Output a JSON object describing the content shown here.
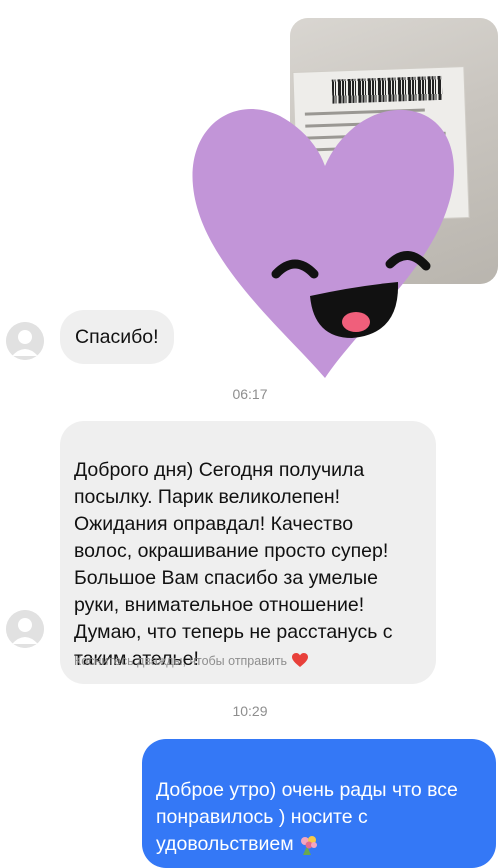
{
  "chat": {
    "messages": [
      {
        "type": "image",
        "direction": "outgoing",
        "content": "photo-with-heart-sticker"
      },
      {
        "type": "text",
        "direction": "incoming",
        "text": "Спасибо!"
      },
      {
        "type": "timestamp",
        "text": "06:17"
      },
      {
        "type": "text",
        "direction": "incoming",
        "text": "Доброго дня) Сегодня получила\nпосылку. Парик великолепен!\nОжидания оправдал! Качество\nволос, окрашивание просто супер!\nБольшое Вам спасибо за умелые\nруки, внимательное отношение!\nДумаю, что теперь  не расстанусь с\nтаким ателье!"
      },
      {
        "type": "hint",
        "text": "Коснитесь дважды, чтобы отправить",
        "icon": "heart-icon"
      },
      {
        "type": "timestamp",
        "text": "10:29"
      },
      {
        "type": "text",
        "direction": "outgoing",
        "text": "Доброе утро) очень рады что все\nпонравилось ) носите с\nудовольствием",
        "emoji": "bouquet-icon"
      }
    ]
  },
  "colors": {
    "outgoing_bubble": "#3478f6",
    "incoming_bubble": "#efefef",
    "sticker_heart": "#c295d8",
    "heart_emoji": "#e8403a",
    "timestamp": "#8e8e8e"
  }
}
